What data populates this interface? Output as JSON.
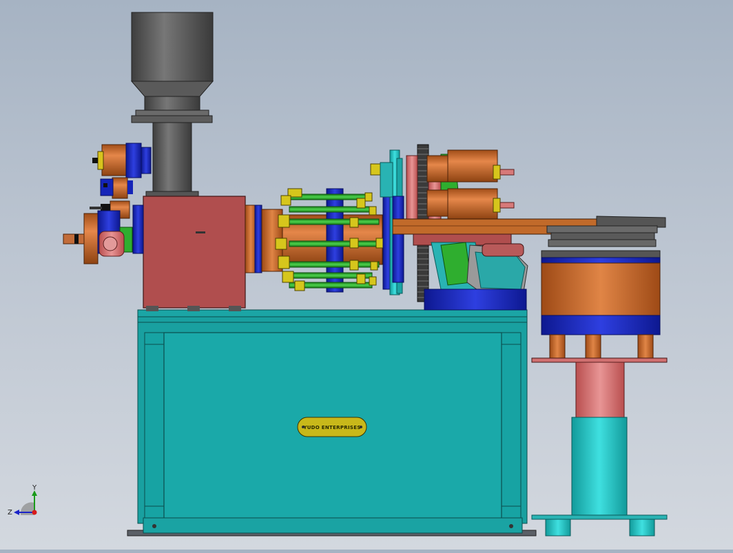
{
  "viewport": {
    "name": "CAD model view",
    "nameplate_text": "YUDO ENTERPRISES"
  },
  "axis_triad": {
    "x_label": "X",
    "y_label": "Y",
    "z_label": "Z"
  },
  "colors": {
    "background_top": "#a6b3c3",
    "background_bottom": "#d3d8df",
    "frame_teal": "#1ba5a5",
    "housing_red": "#b04e4e",
    "copper": "#c1652a",
    "blue": "#1424b8",
    "green": "#2fae2f",
    "yellow": "#d6c61c",
    "hopper_gray": "#4e4e4e",
    "pink": "#d77979",
    "cyan": "#22c8c8"
  }
}
